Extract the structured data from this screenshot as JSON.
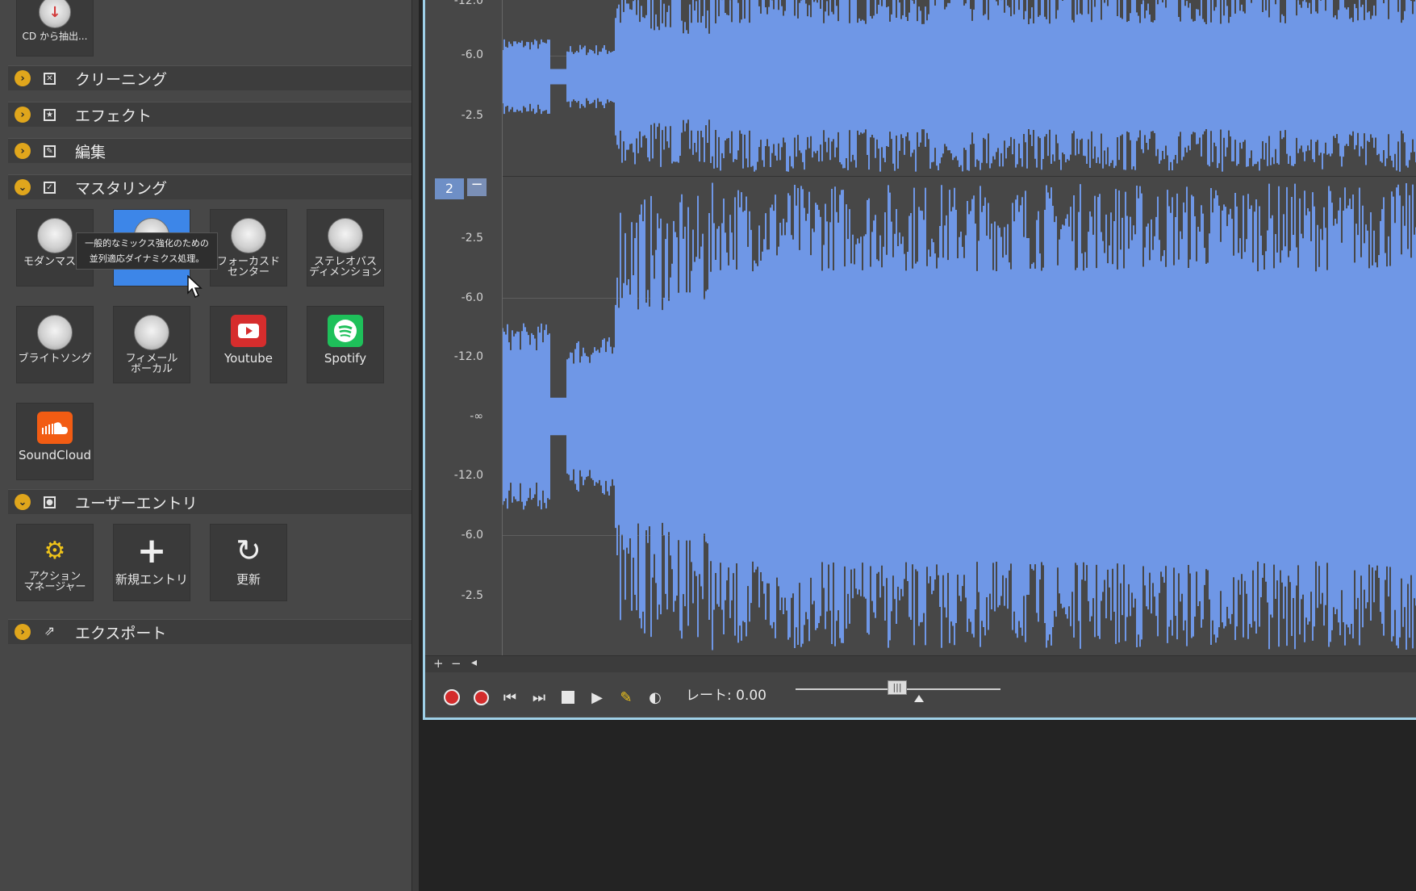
{
  "panel": {
    "cd_tile": {
      "label": "CD から抽出..."
    },
    "sections": [
      {
        "label": "クリーニング",
        "expanded": false,
        "icon": "x-box-icon"
      },
      {
        "label": "エフェクト",
        "expanded": false,
        "icon": "star-box-icon"
      },
      {
        "label": "編集",
        "expanded": false,
        "icon": "edit-box-icon"
      },
      {
        "label": "マスタリング",
        "expanded": true,
        "icon": "check-box-icon"
      },
      {
        "label": "ユーザーエントリ",
        "expanded": true,
        "icon": "user-box-icon"
      },
      {
        "label": "エクスポート",
        "expanded": false,
        "icon": "export-icon"
      }
    ],
    "mastering_tiles": [
      {
        "label": "モダンマスタ",
        "icon": "disc-icon"
      },
      {
        "label": "",
        "icon": "disc-icon",
        "selected": true
      },
      {
        "label": "フォーカスド\nセンター",
        "icon": "disc-icon"
      },
      {
        "label": "ステレオバス\nディメンション",
        "icon": "disc-icon"
      },
      {
        "label": "ブライトソング",
        "icon": "disc-icon"
      },
      {
        "label": "フィメール\nボーカル",
        "icon": "disc-icon"
      },
      {
        "label": "Youtube",
        "icon": "youtube-icon"
      },
      {
        "label": "Spotify",
        "icon": "spotify-icon"
      },
      {
        "label": "SoundCloud",
        "icon": "soundcloud-icon"
      }
    ],
    "user_tiles": [
      {
        "label": "アクション\nマネージャー",
        "icon": "gear-icon"
      },
      {
        "label": "新規エントリ",
        "icon": "plus-icon"
      },
      {
        "label": "更新",
        "icon": "refresh-icon"
      }
    ],
    "tooltip": {
      "line1": "一般的なミックス強化のための",
      "line2": "並列適応ダイナミクス処理。"
    }
  },
  "waveform": {
    "track_number": "2",
    "top_labels": [
      "-12.0",
      "-6.0",
      "-2.5"
    ],
    "bottom_labels": [
      "-2.5",
      "-6.0",
      "-12.0",
      "-∞",
      "-12.0",
      "-6.0",
      "-2.5"
    ],
    "color": "#6f97e6"
  },
  "transport": {
    "rate_label": "レート: 0.00",
    "zoom_plus": "+",
    "zoom_minus": "−",
    "scroll_left": "◂"
  }
}
